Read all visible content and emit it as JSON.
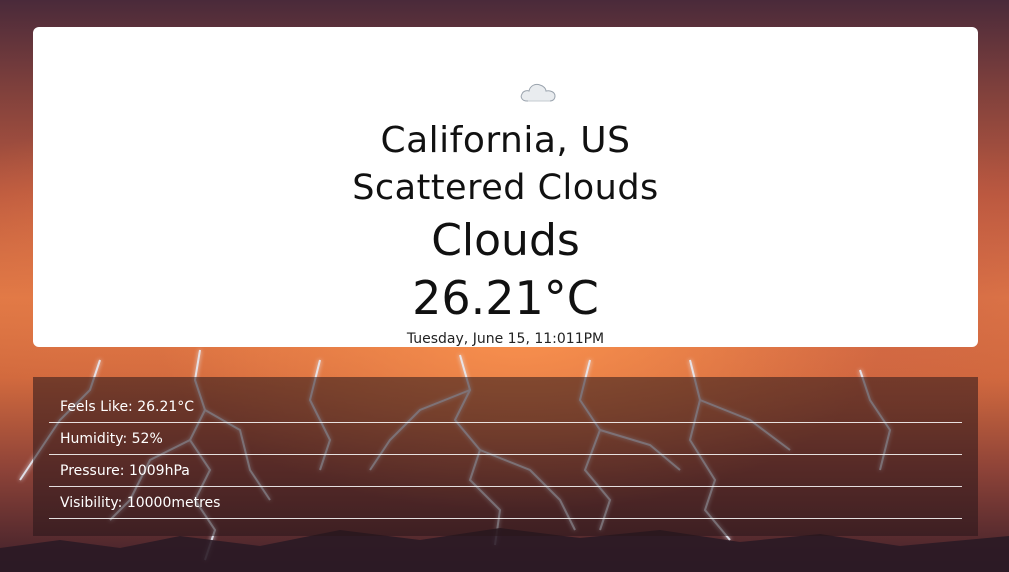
{
  "weather": {
    "icon": "cloud-icon",
    "location": "California, US",
    "description": "Scattered Clouds",
    "condition": "Clouds",
    "temperature": "26.21°C",
    "datetime": "Tuesday, June 15, 11:011PM"
  },
  "details": {
    "feels_like": "Feels Like: 26.21°C",
    "humidity": "Humidity: 52%",
    "pressure": "Pressure: 1009hPa",
    "visibility": "Visibility: 10000metres"
  },
  "colors": {
    "card_background": "#ffffff",
    "panel_background": "rgba(40,22,25,0.55)",
    "text_dark": "#111111",
    "text_light": "#ffffff"
  }
}
